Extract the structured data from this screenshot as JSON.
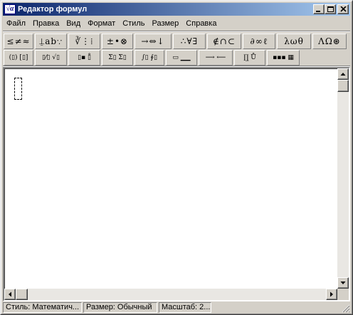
{
  "window": {
    "title": "Редактор формул",
    "icon_text": "√α"
  },
  "menu": [
    "Файл",
    "Правка",
    "Вид",
    "Формат",
    "Стиль",
    "Размер",
    "Справка"
  ],
  "palette_row1": [
    {
      "name": "relations",
      "symbols": "≤≠≈"
    },
    {
      "name": "spaces-ellipses",
      "symbols": "⍊ab∵"
    },
    {
      "name": "embellishments",
      "symbols": "∛⋮⁞"
    },
    {
      "name": "operators",
      "symbols": "±•⊗"
    },
    {
      "name": "arrows",
      "symbols": "→⇔↓"
    },
    {
      "name": "logic",
      "symbols": "∴∀∃"
    },
    {
      "name": "sets",
      "symbols": "∉∩⊂"
    },
    {
      "name": "misc",
      "symbols": "∂∞ℓ"
    },
    {
      "name": "greek-lower",
      "symbols": "λωθ"
    },
    {
      "name": "greek-upper",
      "symbols": "ΛΩ⊛"
    }
  ],
  "palette_row2": [
    {
      "name": "fences",
      "symbols": "(▯) [▯]"
    },
    {
      "name": "fractions-radicals",
      "symbols": "▯⁄▯ √▯"
    },
    {
      "name": "scripts",
      "symbols": "▯▪ ▯̊"
    },
    {
      "name": "sums",
      "symbols": "Σ▯ Σ▯"
    },
    {
      "name": "integrals",
      "symbols": "∫▯ ∮▯"
    },
    {
      "name": "bars",
      "symbols": "▭ ▁▁"
    },
    {
      "name": "labeled-arrows",
      "symbols": "⟶ ⟵"
    },
    {
      "name": "products",
      "symbols": "∏̲ Ů"
    },
    {
      "name": "matrices",
      "symbols": "▪▪▪ ▦"
    }
  ],
  "status": {
    "style": "Стиль: Математич...",
    "size": "Размер: Обычный",
    "zoom": "Масштаб: 2..."
  },
  "colors": {
    "titlebar_start": "#0a246a",
    "titlebar_end": "#a6caf0",
    "face": "#d4d0c8"
  }
}
